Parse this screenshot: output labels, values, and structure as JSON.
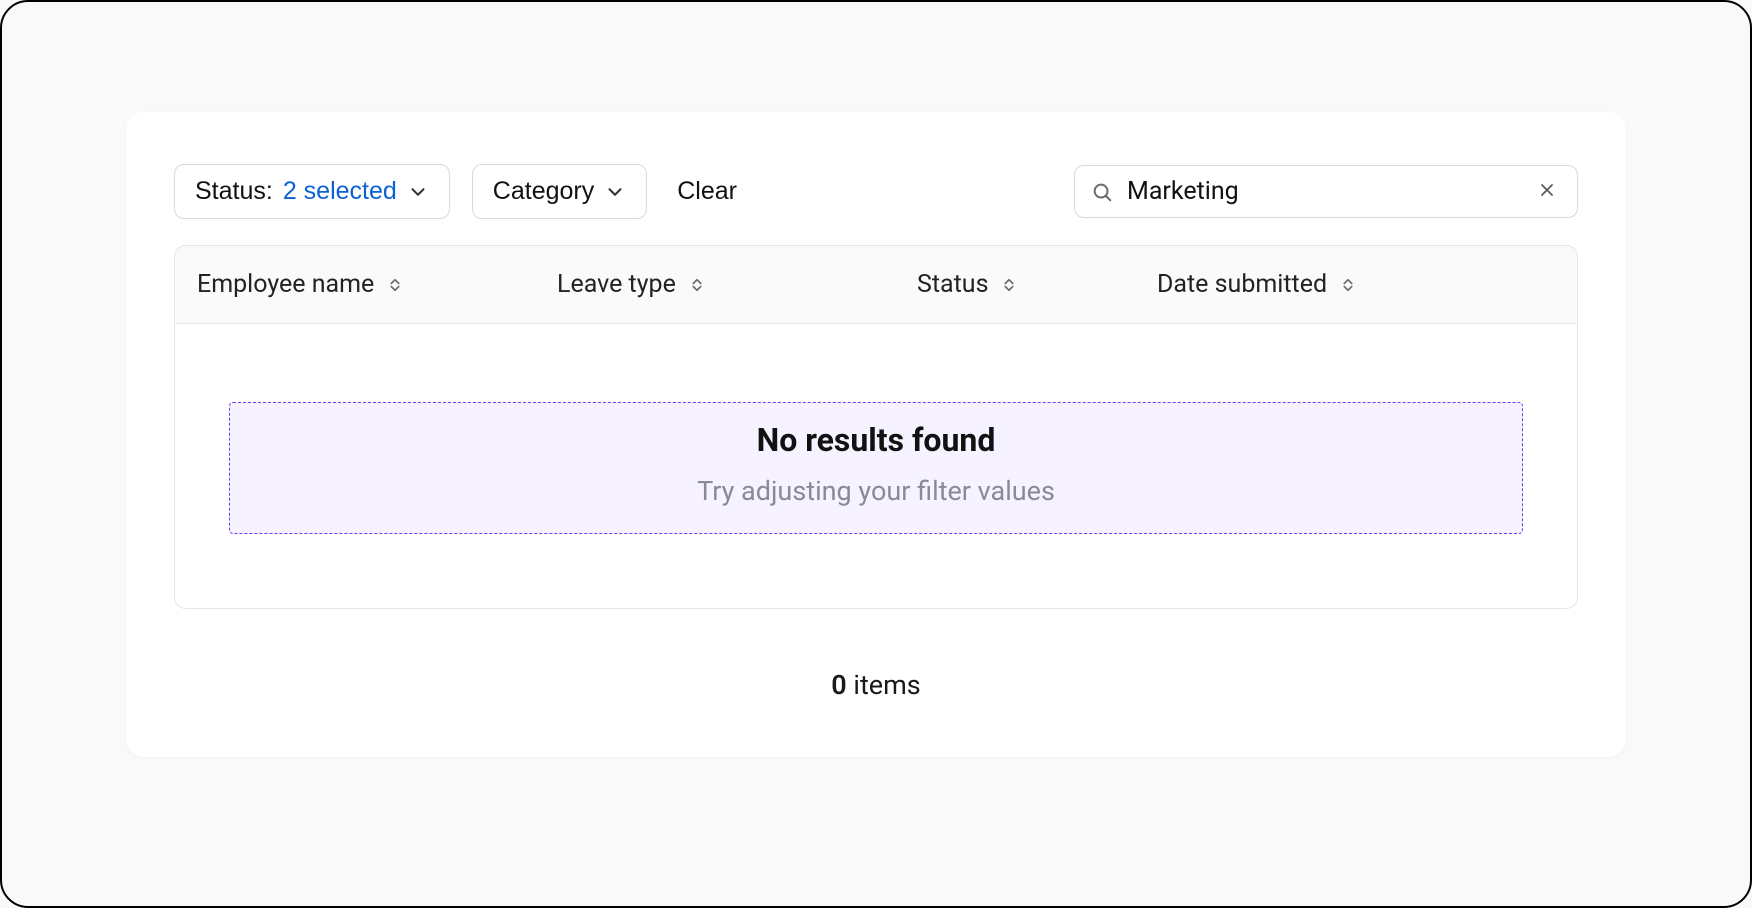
{
  "toolbar": {
    "status_filter": {
      "label": "Status:",
      "selected_text": "2 selected"
    },
    "category_filter": {
      "label": "Category"
    },
    "clear_label": "Clear",
    "search": {
      "value": "Marketing",
      "placeholder": ""
    }
  },
  "columns": [
    {
      "label": "Employee name"
    },
    {
      "label": "Leave type"
    },
    {
      "label": "Status"
    },
    {
      "label": "Date submitted"
    }
  ],
  "empty_state": {
    "title": "No results found",
    "subtitle": "Try adjusting your filter values"
  },
  "footer": {
    "count": "0",
    "items_label": "items"
  }
}
